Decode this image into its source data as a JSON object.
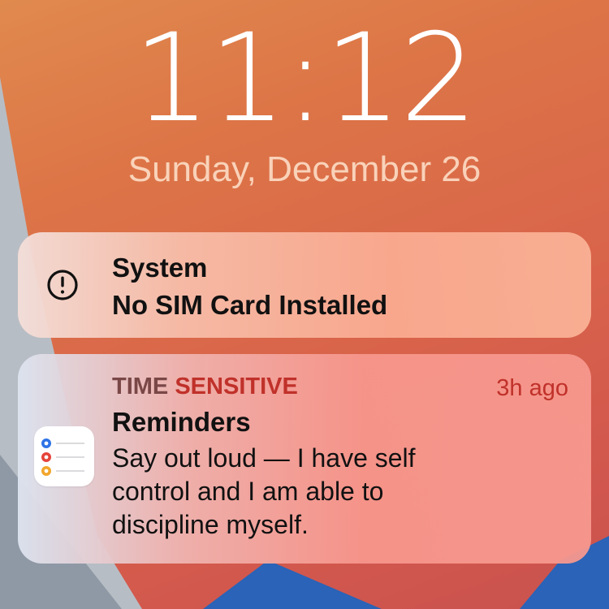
{
  "lock_screen": {
    "time": "11:12",
    "date": "Sunday, December 26"
  },
  "notifications": [
    {
      "app": "System",
      "message": "No SIM Card Installed",
      "icon": "exclamation-circle-icon"
    },
    {
      "label_time": "TIME",
      "label_sensitive": "SENSITIVE",
      "app": "Reminders",
      "timestamp": "3h ago",
      "body_lines": [
        "Say out loud — I have self",
        "control and I am able to",
        "discipline myself."
      ],
      "icon": "reminders-app-icon"
    }
  ],
  "colors": {
    "time_sensitive_red": "#c0312a",
    "time_word": "#7a4747",
    "wallpaper_orange": "#dd7547",
    "wallpaper_blue": "#2e62b8"
  }
}
